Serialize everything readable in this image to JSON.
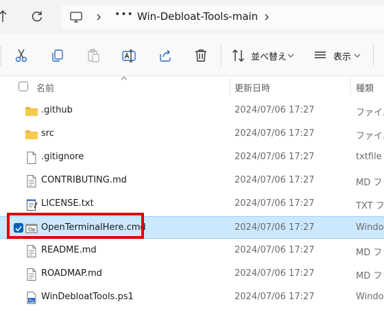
{
  "address": {
    "more": "•••",
    "folder": "Win-Debloat-Tools-main"
  },
  "toolbar": {
    "sort_label": "並べ替え",
    "view_label": "表示"
  },
  "columns": {
    "name": "名前",
    "date": "更新日時",
    "type": "種類"
  },
  "files": [
    {
      "name": ".github",
      "date": "2024/07/06 17:27",
      "type": "ファイル",
      "icon": "folder-icon"
    },
    {
      "name": "src",
      "date": "2024/07/06 17:27",
      "type": "ファイル",
      "icon": "folder-icon"
    },
    {
      "name": ".gitignore",
      "date": "2024/07/06 17:27",
      "type": "txtfile",
      "icon": "file-icon"
    },
    {
      "name": "CONTRIBUTING.md",
      "date": "2024/07/06 17:27",
      "type": "MD ファ",
      "icon": "text-file-icon"
    },
    {
      "name": "LICENSE.txt",
      "date": "2024/07/06 17:27",
      "type": "TXT ファ",
      "icon": "notepad-file-icon"
    },
    {
      "name": "OpenTerminalHere.cmd",
      "date": "2024/07/06 17:27",
      "type": "Window",
      "icon": "cmd-file-icon",
      "selected": true
    },
    {
      "name": "README.md",
      "date": "2024/07/06 17:27",
      "type": "MD ファ",
      "icon": "text-file-icon"
    },
    {
      "name": "ROADMAP.md",
      "date": "2024/07/06 17:27",
      "type": "MD ファ",
      "icon": "text-file-icon"
    },
    {
      "name": "WinDebloatTools.ps1",
      "date": "2024/07/06 17:27",
      "type": "Window",
      "icon": "ps1-file-icon"
    }
  ],
  "colors": {
    "selection": "#cce8ff",
    "accent": "#005fb8",
    "highlight": "#e00000",
    "folder": "#f5c542"
  }
}
